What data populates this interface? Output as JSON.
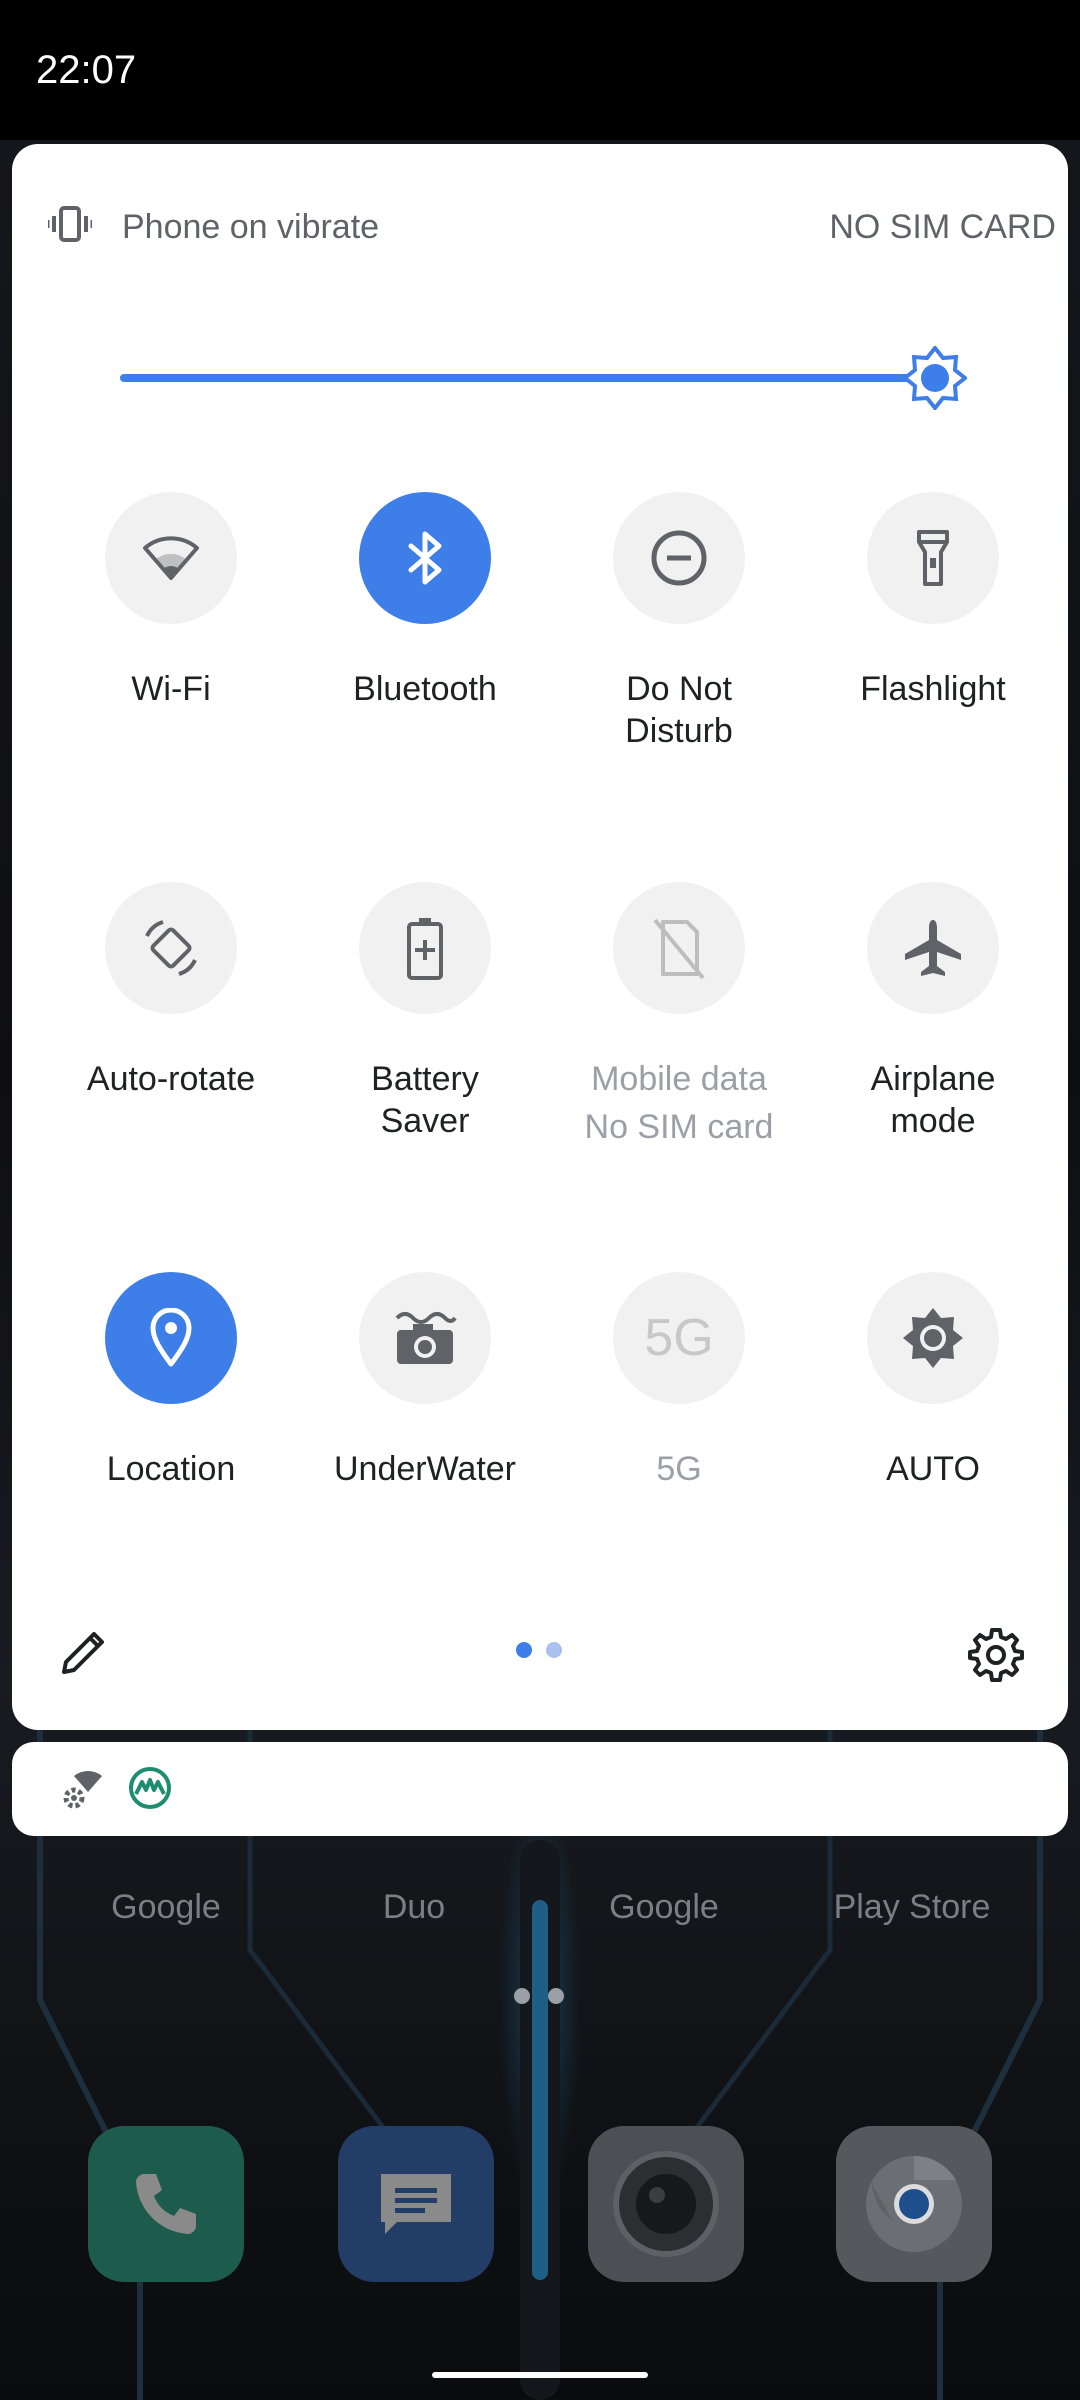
{
  "status_bar": {
    "time": "22:07"
  },
  "header": {
    "ringer_text": "Phone on vibrate",
    "sim_text": "NO SIM CARD"
  },
  "brightness": {
    "level": 0.97
  },
  "tiles": [
    {
      "label": "Wi-Fi",
      "state": "off"
    },
    {
      "label": "Bluetooth",
      "state": "on"
    },
    {
      "label": "Do Not",
      "label2": "Disturb",
      "state": "off"
    },
    {
      "label": "Flashlight",
      "state": "off"
    },
    {
      "label": "Auto-rotate",
      "state": "off"
    },
    {
      "label": "Battery",
      "label2": "Saver",
      "state": "off"
    },
    {
      "label": "Mobile data",
      "label2": "No SIM card",
      "state": "unavailable"
    },
    {
      "label": "Airplane",
      "label2": "mode",
      "state": "off"
    },
    {
      "label": "Location",
      "state": "on"
    },
    {
      "label": "UnderWater",
      "state": "off"
    },
    {
      "label": "5G",
      "icon_text": "5G",
      "state": "unavailable"
    },
    {
      "label": "AUTO",
      "state": "off"
    }
  ],
  "footer": {
    "page_count": 2,
    "current_page": 1
  },
  "home": {
    "apps": [
      "Google",
      "Duo",
      "Google",
      "Play Store"
    ]
  },
  "colors": {
    "accent": "#3e7ee8",
    "tile_off": "#f1f1f1",
    "panel": "#ffffff"
  },
  "icons": {
    "header": "vibrate-icon",
    "tiles": [
      "wifi-icon",
      "bluetooth-icon",
      "do-not-disturb-icon",
      "flashlight-icon",
      "auto-rotate-icon",
      "battery-saver-icon",
      "mobile-data-icon",
      "airplane-icon",
      "location-icon",
      "underwater-camera-icon",
      "5g-icon",
      "auto-brightness-icon"
    ]
  }
}
